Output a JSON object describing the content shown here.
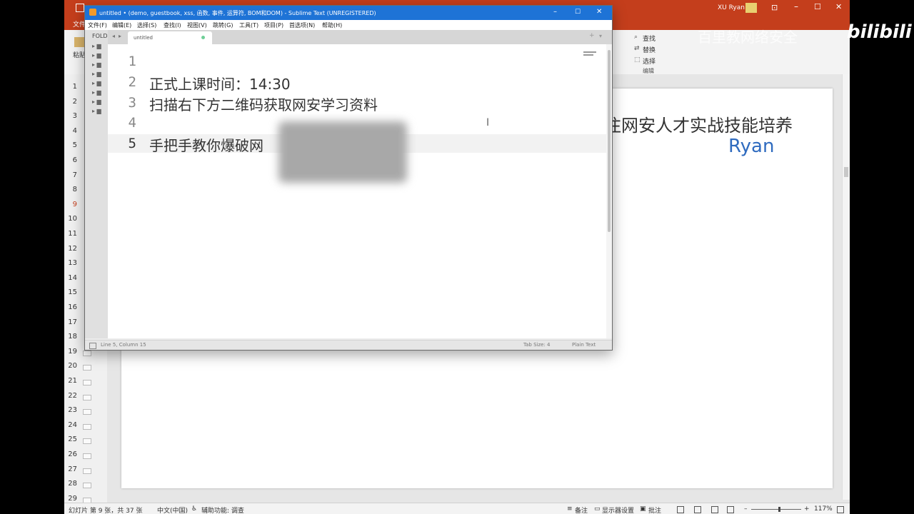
{
  "ppt": {
    "title_user": "XU Ryan",
    "menu_first": "文件",
    "paste_label": "粘贴",
    "find_label": "查找",
    "replace_label": "替换",
    "select_label": "选择",
    "edit_group_label": "编辑",
    "slide_text_line1": "注网安人才实战技能培养",
    "slide_text_line2": "Ryan",
    "slide_numbers": [
      "1",
      "2",
      "3",
      "4",
      "5",
      "6",
      "7",
      "8",
      "9",
      "10",
      "11",
      "12",
      "13",
      "14",
      "15",
      "16",
      "17",
      "18",
      "19",
      "20",
      "21",
      "22",
      "23",
      "24",
      "25",
      "26",
      "27",
      "28",
      "29"
    ],
    "status_slide": "幻灯片 第 9 张，共 37 张",
    "status_lang": "中文(中国)",
    "status_access": "辅助功能: 调查",
    "status_notes": "备注",
    "status_display": "显示器设置",
    "status_comments": "批注",
    "status_zoom": "117%"
  },
  "overlay": {
    "brand": "百里教网络安全",
    "bilibili": "bilibili"
  },
  "sublime": {
    "window_title": "untitled • (demo, guestbook, xss, 函数, 事件, 运算符, BOM和DOM) - Sublime Text (UNREGISTERED)",
    "menu": [
      "文件(F)",
      "编辑(E)",
      "选择(S)",
      "查找(I)",
      "视图(V)",
      "跳转(G)",
      "工具(T)",
      "项目(P)",
      "首选项(N)",
      "帮助(H)"
    ],
    "folders_label": "FOLD",
    "tab_label": "untitled",
    "lines": [
      {
        "num": "1",
        "text": ""
      },
      {
        "num": "2",
        "text": "正式上课时间：14:30"
      },
      {
        "num": "3",
        "text": "扫描右下方二维码获取网安学习资料"
      },
      {
        "num": "4",
        "text": ""
      },
      {
        "num": "5",
        "text": "手把手教你爆破网"
      }
    ],
    "status_position": "Line 5, Column 15",
    "status_tabsize": "Tab Size: 4",
    "status_syntax": "Plain Text"
  }
}
